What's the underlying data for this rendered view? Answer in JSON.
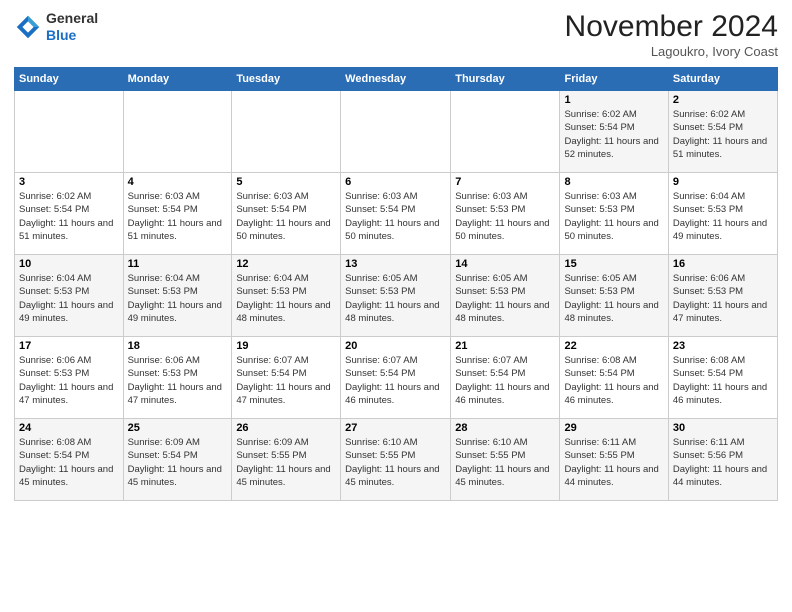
{
  "header": {
    "logo_line1": "General",
    "logo_line2": "Blue",
    "month_title": "November 2024",
    "location": "Lagoukro, Ivory Coast"
  },
  "weekdays": [
    "Sunday",
    "Monday",
    "Tuesday",
    "Wednesday",
    "Thursday",
    "Friday",
    "Saturday"
  ],
  "weeks": [
    [
      {
        "day": "",
        "info": ""
      },
      {
        "day": "",
        "info": ""
      },
      {
        "day": "",
        "info": ""
      },
      {
        "day": "",
        "info": ""
      },
      {
        "day": "",
        "info": ""
      },
      {
        "day": "1",
        "info": "Sunrise: 6:02 AM\nSunset: 5:54 PM\nDaylight: 11 hours and 52 minutes."
      },
      {
        "day": "2",
        "info": "Sunrise: 6:02 AM\nSunset: 5:54 PM\nDaylight: 11 hours and 51 minutes."
      }
    ],
    [
      {
        "day": "3",
        "info": "Sunrise: 6:02 AM\nSunset: 5:54 PM\nDaylight: 11 hours and 51 minutes."
      },
      {
        "day": "4",
        "info": "Sunrise: 6:03 AM\nSunset: 5:54 PM\nDaylight: 11 hours and 51 minutes."
      },
      {
        "day": "5",
        "info": "Sunrise: 6:03 AM\nSunset: 5:54 PM\nDaylight: 11 hours and 50 minutes."
      },
      {
        "day": "6",
        "info": "Sunrise: 6:03 AM\nSunset: 5:54 PM\nDaylight: 11 hours and 50 minutes."
      },
      {
        "day": "7",
        "info": "Sunrise: 6:03 AM\nSunset: 5:53 PM\nDaylight: 11 hours and 50 minutes."
      },
      {
        "day": "8",
        "info": "Sunrise: 6:03 AM\nSunset: 5:53 PM\nDaylight: 11 hours and 50 minutes."
      },
      {
        "day": "9",
        "info": "Sunrise: 6:04 AM\nSunset: 5:53 PM\nDaylight: 11 hours and 49 minutes."
      }
    ],
    [
      {
        "day": "10",
        "info": "Sunrise: 6:04 AM\nSunset: 5:53 PM\nDaylight: 11 hours and 49 minutes."
      },
      {
        "day": "11",
        "info": "Sunrise: 6:04 AM\nSunset: 5:53 PM\nDaylight: 11 hours and 49 minutes."
      },
      {
        "day": "12",
        "info": "Sunrise: 6:04 AM\nSunset: 5:53 PM\nDaylight: 11 hours and 48 minutes."
      },
      {
        "day": "13",
        "info": "Sunrise: 6:05 AM\nSunset: 5:53 PM\nDaylight: 11 hours and 48 minutes."
      },
      {
        "day": "14",
        "info": "Sunrise: 6:05 AM\nSunset: 5:53 PM\nDaylight: 11 hours and 48 minutes."
      },
      {
        "day": "15",
        "info": "Sunrise: 6:05 AM\nSunset: 5:53 PM\nDaylight: 11 hours and 48 minutes."
      },
      {
        "day": "16",
        "info": "Sunrise: 6:06 AM\nSunset: 5:53 PM\nDaylight: 11 hours and 47 minutes."
      }
    ],
    [
      {
        "day": "17",
        "info": "Sunrise: 6:06 AM\nSunset: 5:53 PM\nDaylight: 11 hours and 47 minutes."
      },
      {
        "day": "18",
        "info": "Sunrise: 6:06 AM\nSunset: 5:53 PM\nDaylight: 11 hours and 47 minutes."
      },
      {
        "day": "19",
        "info": "Sunrise: 6:07 AM\nSunset: 5:54 PM\nDaylight: 11 hours and 47 minutes."
      },
      {
        "day": "20",
        "info": "Sunrise: 6:07 AM\nSunset: 5:54 PM\nDaylight: 11 hours and 46 minutes."
      },
      {
        "day": "21",
        "info": "Sunrise: 6:07 AM\nSunset: 5:54 PM\nDaylight: 11 hours and 46 minutes."
      },
      {
        "day": "22",
        "info": "Sunrise: 6:08 AM\nSunset: 5:54 PM\nDaylight: 11 hours and 46 minutes."
      },
      {
        "day": "23",
        "info": "Sunrise: 6:08 AM\nSunset: 5:54 PM\nDaylight: 11 hours and 46 minutes."
      }
    ],
    [
      {
        "day": "24",
        "info": "Sunrise: 6:08 AM\nSunset: 5:54 PM\nDaylight: 11 hours and 45 minutes."
      },
      {
        "day": "25",
        "info": "Sunrise: 6:09 AM\nSunset: 5:54 PM\nDaylight: 11 hours and 45 minutes."
      },
      {
        "day": "26",
        "info": "Sunrise: 6:09 AM\nSunset: 5:55 PM\nDaylight: 11 hours and 45 minutes."
      },
      {
        "day": "27",
        "info": "Sunrise: 6:10 AM\nSunset: 5:55 PM\nDaylight: 11 hours and 45 minutes."
      },
      {
        "day": "28",
        "info": "Sunrise: 6:10 AM\nSunset: 5:55 PM\nDaylight: 11 hours and 45 minutes."
      },
      {
        "day": "29",
        "info": "Sunrise: 6:11 AM\nSunset: 5:55 PM\nDaylight: 11 hours and 44 minutes."
      },
      {
        "day": "30",
        "info": "Sunrise: 6:11 AM\nSunset: 5:56 PM\nDaylight: 11 hours and 44 minutes."
      }
    ]
  ]
}
